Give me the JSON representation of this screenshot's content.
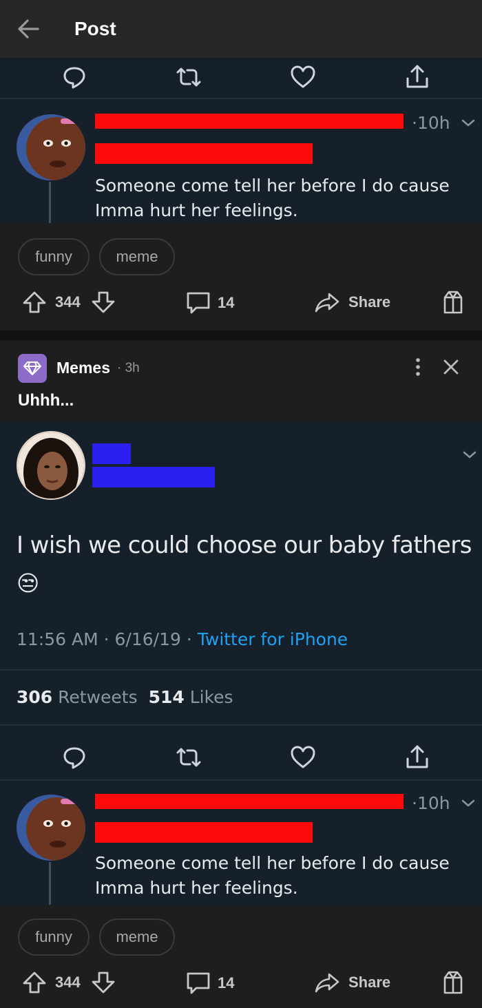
{
  "header": {
    "title": "Post"
  },
  "top_tweet": {
    "time": "·10h",
    "text_line1": "Someone come tell her before I do cause",
    "text_line2": "Imma hurt her feelings."
  },
  "top_post_tags": [
    "funny",
    "meme"
  ],
  "top_post_actions": {
    "score": "344",
    "comments": "14",
    "share": "Share"
  },
  "post": {
    "community": "Memes",
    "time": "· 3h",
    "title": "Uhhh..."
  },
  "main_tweet": {
    "text_line1": "I wish we could choose our baby fathers",
    "emoji": "😒",
    "time": "11:56 AM",
    "date": "6/16/19",
    "source": "Twitter for iPhone",
    "retweets_count": "306",
    "retweets_label": "Retweets",
    "likes_count": "514",
    "likes_label": "Likes"
  },
  "reply_tweet": {
    "time": "·10h",
    "text_line1": "Someone come tell her before I do cause",
    "text_line2": "Imma hurt her feelings."
  },
  "bottom_post_tags": [
    "funny",
    "meme"
  ],
  "bottom_post_actions": {
    "score": "344",
    "comments": "14",
    "share": "Share"
  },
  "colors": {
    "tweet_bg": "#15202b",
    "twitter_link": "#1da1f2",
    "redaction_red": "#ff0a0a",
    "redaction_blue": "#2b1ff0",
    "community_icon": "#8d6bc9"
  }
}
